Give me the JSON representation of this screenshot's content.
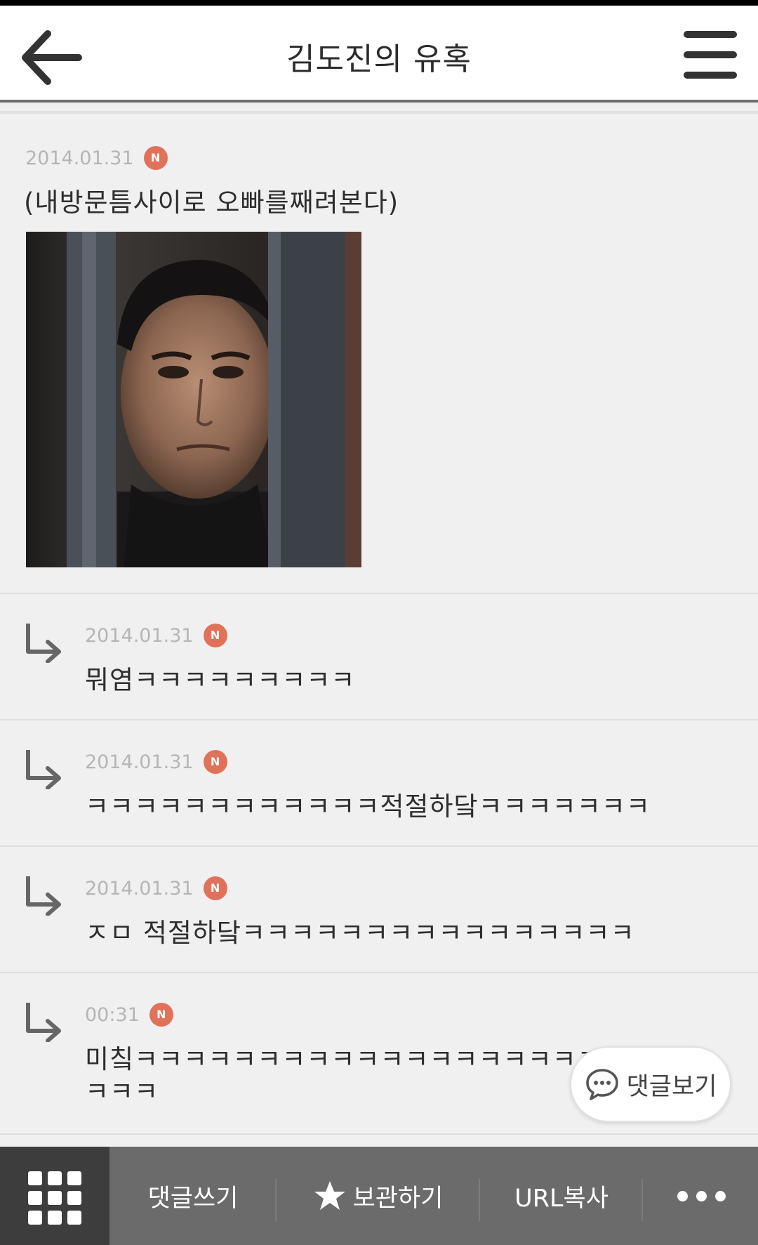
{
  "header": {
    "title": "김도진의 유혹"
  },
  "post": {
    "date": "2014.01.31",
    "badge": "N",
    "text": "(내방문틈사이로 오빠를째려본다)"
  },
  "comments": [
    {
      "date": "2014.01.31",
      "badge": "N",
      "text": "뭐염ㅋㅋㅋㅋㅋㅋㅋㅋㅋ"
    },
    {
      "date": "2014.01.31",
      "badge": "N",
      "text": "ㅋㅋㅋㅋㅋㅋㅋㅋㅋㅋㅋㅋ적절하닼ㅋㅋㅋㅋㅋㅋㅋ"
    },
    {
      "date": "2014.01.31",
      "badge": "N",
      "text": "ㅈㅁ 적절하닼ㅋㅋㅋㅋㅋㅋㅋㅋㅋㅋㅋㅋㅋㅋㅋㅋ"
    },
    {
      "date": "00:31",
      "badge": "N",
      "text_line1": "미칰ㅋㅋㅋㅋㅋㅋㅋㅋㅋㅋㅋㅋㅋㅋㅋㅋㅋㅋㅋㅋㅋㅋ",
      "text_line2": "ㅋㅋㅋ"
    }
  ],
  "fab": {
    "label": "댓글보기"
  },
  "bottom_bar": {
    "write_comment": "댓글쓰기",
    "save": "보관하기",
    "copy_url": "URL복사"
  },
  "icons": {
    "back": "arrow-left-icon",
    "menu": "hamburger-icon",
    "reply": "reply-arrow-icon",
    "grid": "grid-icon",
    "star": "star-icon",
    "chat": "chat-bubble-icon",
    "more": "more-dots-icon"
  },
  "colors": {
    "badge": "#e0725a",
    "bottom_bar": "#6b6b6b"
  }
}
